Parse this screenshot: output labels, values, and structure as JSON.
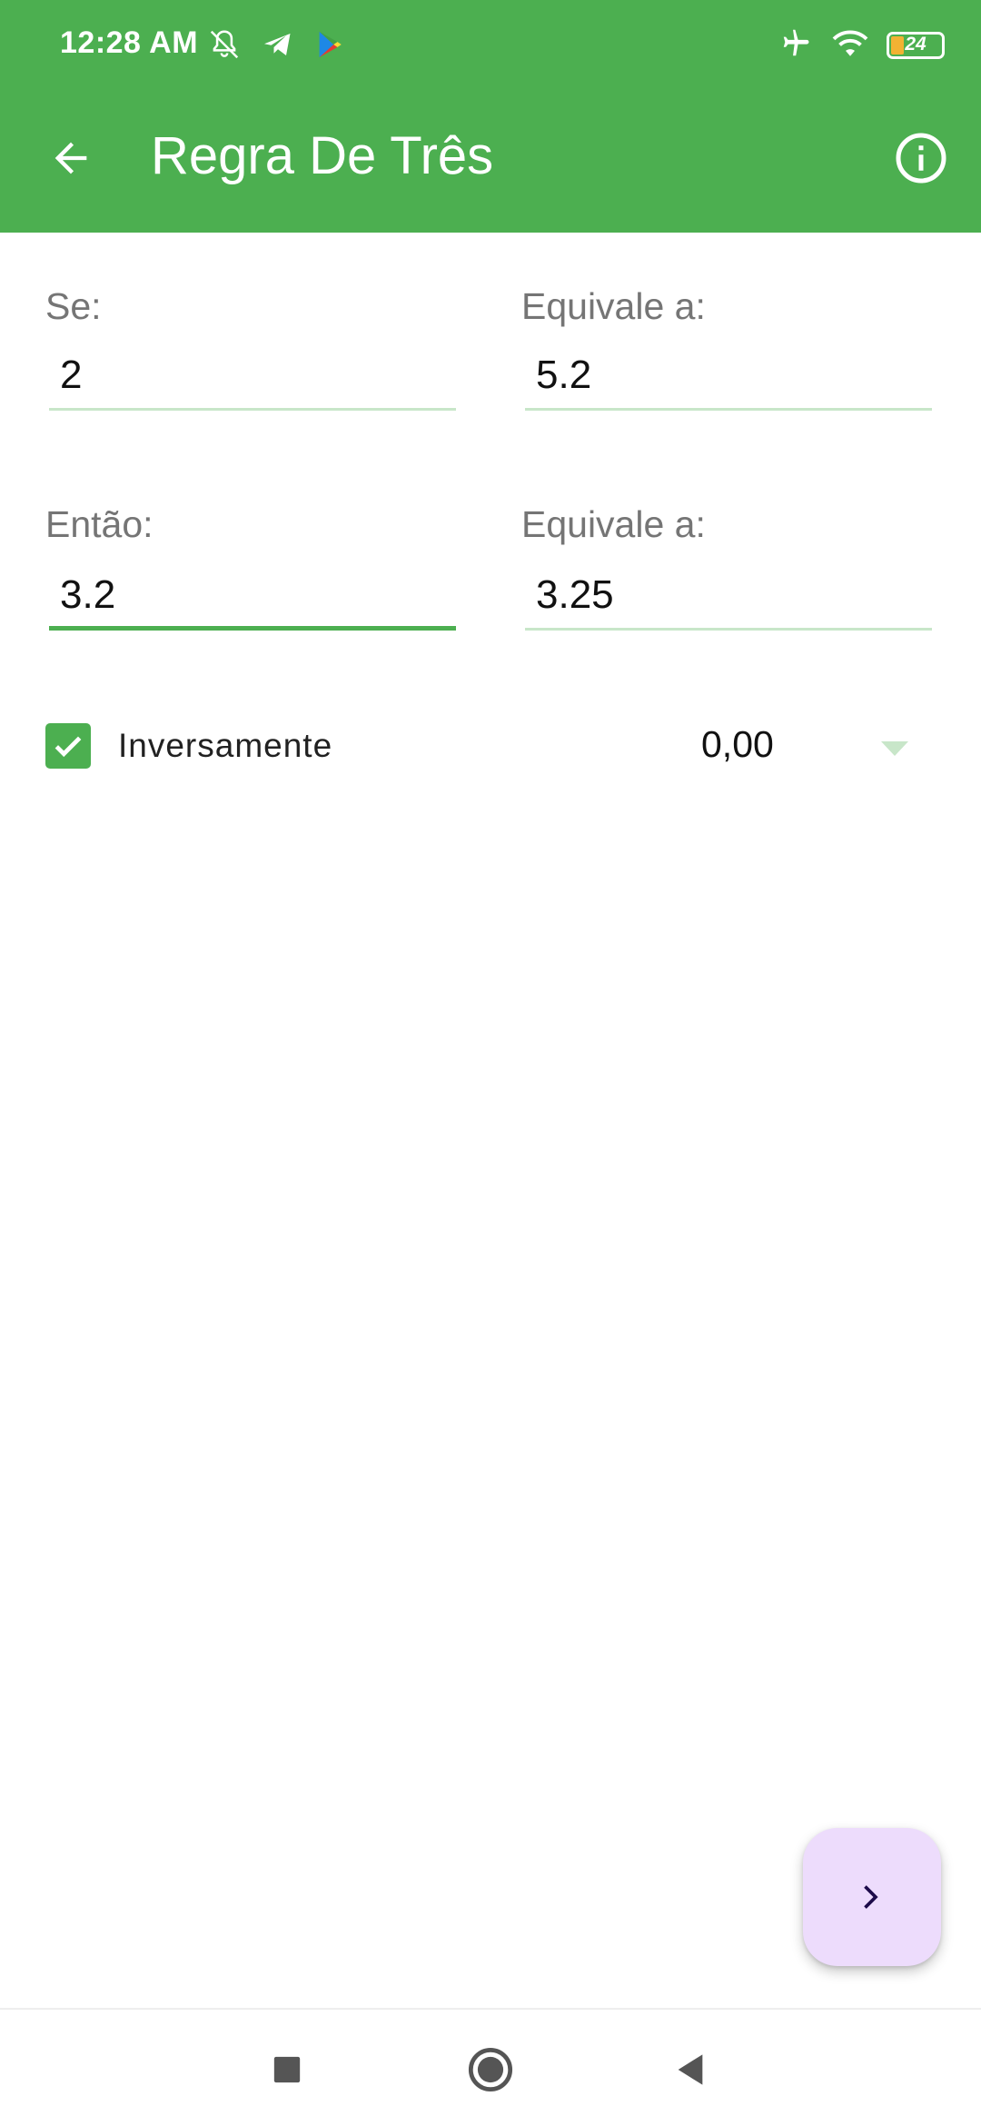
{
  "status_bar": {
    "time": "12:28 AM",
    "battery_level": "24",
    "battery_fraction": 0.24,
    "left_icons": [
      "bell-off-icon",
      "telegram-icon",
      "play-store-icon"
    ],
    "right_icons": [
      "airplane-icon",
      "wifi-icon",
      "battery-icon"
    ]
  },
  "app_bar": {
    "title": "Regra De Três",
    "background": "#4caf50"
  },
  "form": {
    "se": {
      "label": "Se:",
      "value": "2"
    },
    "equivale_1": {
      "label": "Equivale a:",
      "value": "5.2"
    },
    "entao": {
      "label": "Então:",
      "value": "3.2"
    },
    "equivale_2": {
      "label": "Equivale a:",
      "value": "3.25"
    },
    "inversamente": {
      "label": "Inversamente",
      "checked": true
    },
    "precision": {
      "value": "0,00"
    }
  },
  "colors": {
    "accent": "#4caf50",
    "underline": "#c8e6c9",
    "fab_background": "#eddcfc",
    "fab_icon": "#1d0b4a",
    "label_gray": "#757575"
  },
  "fab": {
    "icon": "chevron-right-icon"
  },
  "nav_bar": {
    "buttons": [
      "recent-apps-icon",
      "home-icon",
      "back-icon"
    ]
  }
}
